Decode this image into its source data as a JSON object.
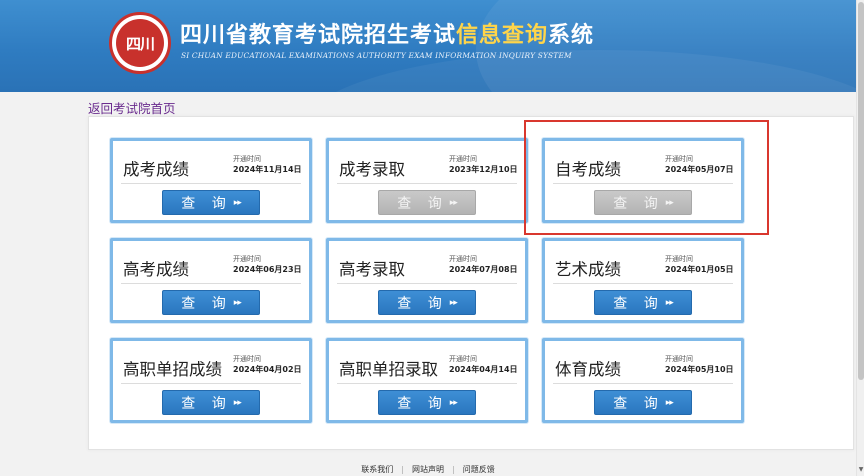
{
  "header": {
    "logo_text": "四川",
    "title_prefix": "四川省教育考试院招生考试",
    "title_highlight": "信息查询",
    "title_suffix": "系统",
    "subtitle_en": "SI CHUAN EDUCATIONAL EXAMINATIONS AUTHORITY EXAM INFORMATION INQUIRY SYSTEM"
  },
  "back_link": "返回考试院首页",
  "cards": [
    {
      "name": "成考成绩",
      "open_label": "开通时间",
      "open_date": "2024年11月14日",
      "button": "查 询",
      "enabled": true
    },
    {
      "name": "成考录取",
      "open_label": "开通时间",
      "open_date": "2023年12月10日",
      "button": "查 询",
      "enabled": false
    },
    {
      "name": "自考成绩",
      "open_label": "开通时间",
      "open_date": "2024年05月07日",
      "button": "查 询",
      "enabled": false
    },
    {
      "name": "高考成绩",
      "open_label": "开通时间",
      "open_date": "2024年06月23日",
      "button": "查 询",
      "enabled": true
    },
    {
      "name": "高考录取",
      "open_label": "开通时间",
      "open_date": "2024年07月08日",
      "button": "查 询",
      "enabled": true
    },
    {
      "name": "艺术成绩",
      "open_label": "开通时间",
      "open_date": "2024年01月05日",
      "button": "查 询",
      "enabled": true
    },
    {
      "name": "高职单招成绩",
      "open_label": "开通时间",
      "open_date": "2024年04月02日",
      "button": "查 询",
      "enabled": true
    },
    {
      "name": "高职单招录取",
      "open_label": "开通时间",
      "open_date": "2024年04月14日",
      "button": "查 询",
      "enabled": true
    },
    {
      "name": "体育成绩",
      "open_label": "开通时间",
      "open_date": "2024年05月10日",
      "button": "查 询",
      "enabled": true
    }
  ],
  "arrow_glyph": "▸▸",
  "footer": {
    "links": [
      "联系我们",
      "网站声明",
      "问题反馈"
    ]
  },
  "colors": {
    "header_blue": "#2f7cc1",
    "button_blue": "#2a76bf",
    "button_disabled": "#b3b3b3",
    "card_border": "#7fb9e8",
    "highlight_red": "#d9372e",
    "logo_red": "#c8312c"
  }
}
